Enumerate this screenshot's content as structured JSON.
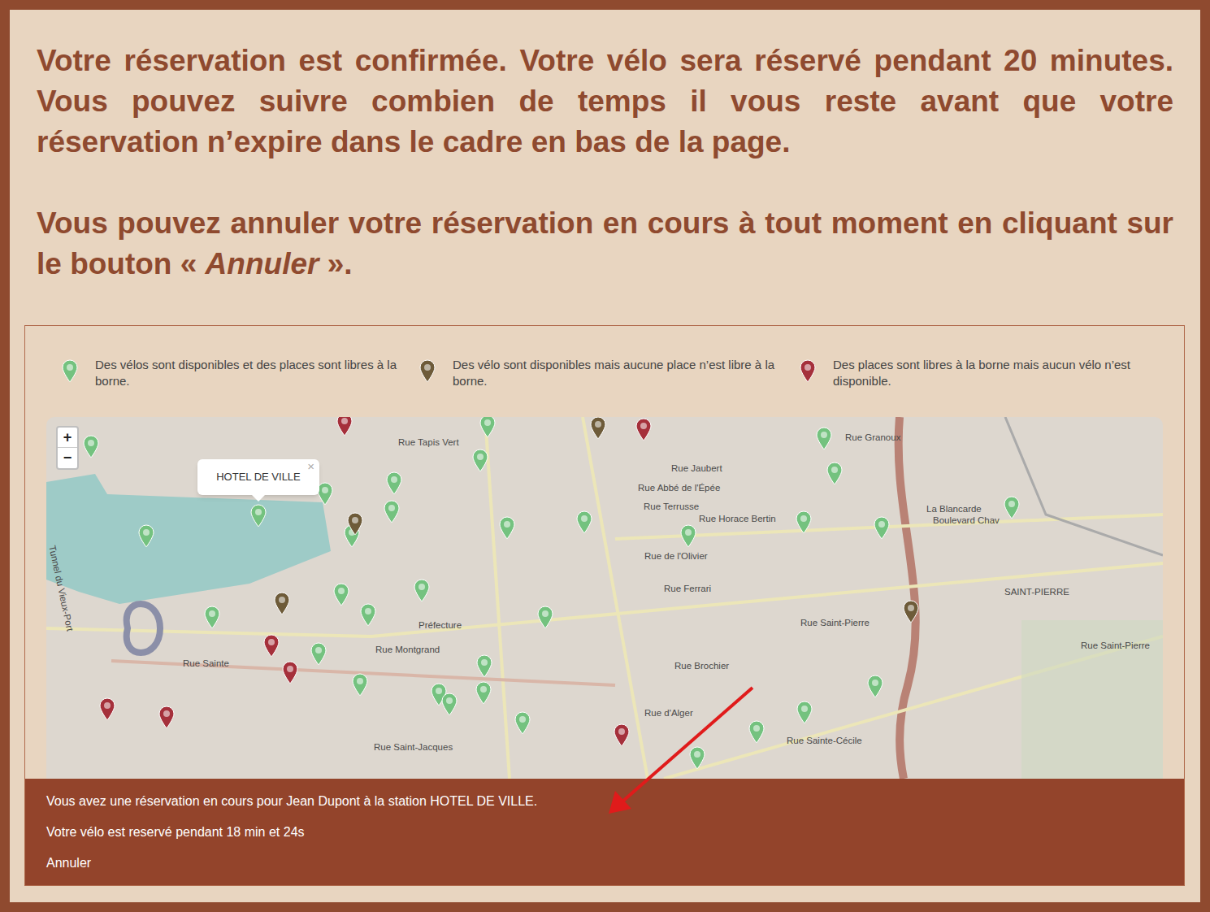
{
  "instructions": {
    "paragraphs": [
      {
        "text": "Votre réservation est confirmée. Votre vélo sera réservé pendant 20 minutes. Vous pouvez suivre combien de temps il vous reste avant que votre réservation n’expire dans le cadre en bas de la page.",
        "emphasis": "",
        "suffix": ""
      },
      {
        "text": "Vous pouvez annuler votre réservation en cours à tout moment en cliquant sur le bouton « ",
        "emphasis": "Annuler",
        "suffix": " »."
      }
    ]
  },
  "legend": [
    {
      "text": "Des vélos sont disponibles et des places sont libres à la borne.",
      "color": "#74c27f"
    },
    {
      "text": "Des vélo sont disponibles mais aucune place n’est libre à la borne.",
      "color": "#6e5b39"
    },
    {
      "text": "Des places sont libres à la borne mais aucun vélo n’est disponible.",
      "color": "#a5303b"
    }
  ],
  "map": {
    "zoom_in": "+",
    "zoom_out": "−",
    "popup": {
      "title": "HOTEL DE VILLE",
      "close": "×"
    },
    "labels": [
      "Rue Granoux",
      "Rue Jaubert",
      "Rue Abbé de l'Épée",
      "Rue Terrusse",
      "Rue Horace Bertin",
      "Rue de l'Olivier",
      "Rue Ferrari",
      "Rue Brochier",
      "Rue d'Alger",
      "Rue Montgrand",
      "Préfecture",
      "Rue Saint-Jacques",
      "Rue Saint-Pierre",
      "La Blancarde",
      "Boulevard Chav",
      "SAINT-PIERRE",
      "Rue Saint-Pierre",
      "Rue Sainte-Cécile",
      "Rue Sainte",
      "Tunnel du Vieux-Port",
      "Rue Tapis Vert"
    ],
    "pins": [
      {
        "color": "#74c27f",
        "selected": false
      },
      {
        "color": "#74c27f",
        "selected": false
      },
      {
        "color": "#74c27f",
        "selected": false
      },
      {
        "color": "#74c27f",
        "selected": false
      },
      {
        "color": "#74c27f",
        "selected": false
      },
      {
        "color": "#74c27f",
        "selected": false
      },
      {
        "color": "#74c27f",
        "selected": false
      },
      {
        "color": "#74c27f",
        "selected": false
      },
      {
        "color": "#74c27f",
        "selected": false
      },
      {
        "color": "#74c27f",
        "selected": false
      },
      {
        "color": "#74c27f",
        "selected": false
      },
      {
        "color": "#74c27f",
        "selected": false
      },
      {
        "color": "#74c27f",
        "selected": false
      },
      {
        "color": "#74c27f",
        "selected": false
      },
      {
        "color": "#74c27f",
        "selected": false
      },
      {
        "color": "#74c27f",
        "selected": false
      },
      {
        "color": "#74c27f",
        "selected": false
      },
      {
        "color": "#74c27f",
        "selected": false
      },
      {
        "color": "#74c27f",
        "selected": false
      },
      {
        "color": "#74c27f",
        "selected": false
      },
      {
        "color": "#74c27f",
        "selected": false
      },
      {
        "color": "#74c27f",
        "selected": false
      },
      {
        "color": "#74c27f",
        "selected": false
      },
      {
        "color": "#74c27f",
        "selected": false
      },
      {
        "color": "#74c27f",
        "selected": false
      },
      {
        "color": "#74c27f",
        "selected": false
      },
      {
        "color": "#74c27f",
        "selected": false
      },
      {
        "color": "#74c27f",
        "selected": false
      },
      {
        "color": "#74c27f",
        "selected": false
      },
      {
        "color": "#74c27f",
        "selected": false
      },
      {
        "color": "#74c27f",
        "selected": false
      },
      {
        "color": "#74c27f",
        "selected": false
      },
      {
        "color": "#6e5b39",
        "selected": false
      },
      {
        "color": "#6e5b39",
        "selected": false
      },
      {
        "color": "#6e5b39",
        "selected": false
      },
      {
        "color": "#6e5b39",
        "selected": false
      },
      {
        "color": "#a5303b",
        "selected": false
      },
      {
        "color": "#a5303b",
        "selected": false
      },
      {
        "color": "#a5303b",
        "selected": false
      },
      {
        "color": "#a5303b",
        "selected": false
      },
      {
        "color": "#a5303b",
        "selected": false
      },
      {
        "color": "#a5303b",
        "selected": false
      },
      {
        "color": "#a5303b",
        "selected": false
      },
      {
        "color": "#74c27f",
        "selected": true
      }
    ]
  },
  "reservation_bar": {
    "message": "Vous avez une réservation en cours pour Jean Dupont à la station HOTEL DE VILLE.",
    "timer": "Votre vélo est reservé pendant 18 min et 24s",
    "cancel": "Annuler"
  }
}
